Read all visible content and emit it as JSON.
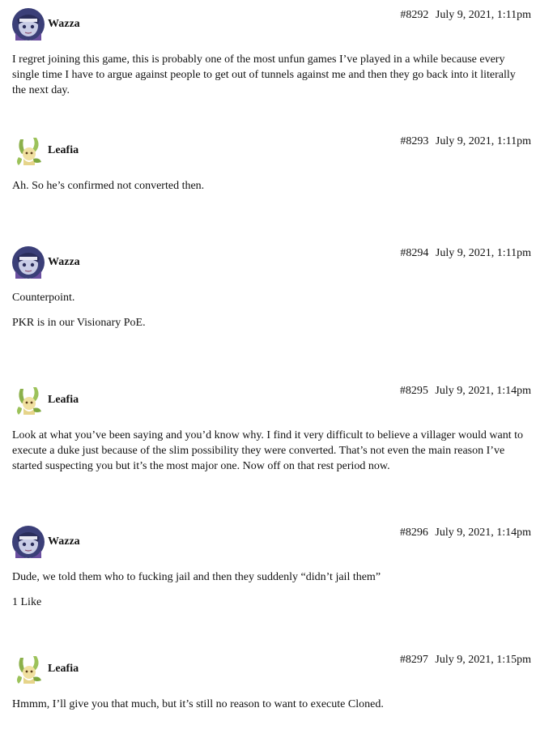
{
  "posts": [
    {
      "username": "Wazza",
      "avatar": "wazza-avatar",
      "number": "#8292",
      "date": "July 9, 2021, 1:11pm",
      "paragraphs": [
        "I regret joining this game, this is probably one of the most unfun games I’ve played in a while because every single time I have to argue against people to get out of tunnels against me and then they go back into it literally the next day."
      ]
    },
    {
      "username": "Leafia",
      "avatar": "leafia-avatar",
      "number": "#8293",
      "date": "July 9, 2021, 1:11pm",
      "paragraphs": [
        "Ah. So he’s confirmed not converted then."
      ]
    },
    {
      "username": "Wazza",
      "avatar": "wazza-avatar",
      "number": "#8294",
      "date": "July 9, 2021, 1:11pm",
      "paragraphs": [
        "Counterpoint.",
        "PKR is in our Visionary PoE."
      ]
    },
    {
      "username": "Leafia",
      "avatar": "leafia-avatar",
      "number": "#8295",
      "date": "July 9, 2021, 1:14pm",
      "paragraphs": [
        "Look at what you’ve been saying and you’d know why. I find it very difficult to believe a villager would want to execute a duke just because of the slim possibility they were converted. That’s not even the main reason I’ve started suspecting you but it’s the most major one. Now off on that rest period now."
      ]
    },
    {
      "username": "Wazza",
      "avatar": "wazza-avatar",
      "number": "#8296",
      "date": "July 9, 2021, 1:14pm",
      "paragraphs": [
        "Dude, we told them who to fucking jail and then they suddenly “didn’t jail them”"
      ],
      "likes": "1 Like"
    },
    {
      "username": "Leafia",
      "avatar": "leafia-avatar",
      "number": "#8297",
      "date": "July 9, 2021, 1:15pm",
      "paragraphs": [
        "Hmmm, I’ll give you that much, but it’s still no reason to want to execute Cloned."
      ]
    }
  ]
}
